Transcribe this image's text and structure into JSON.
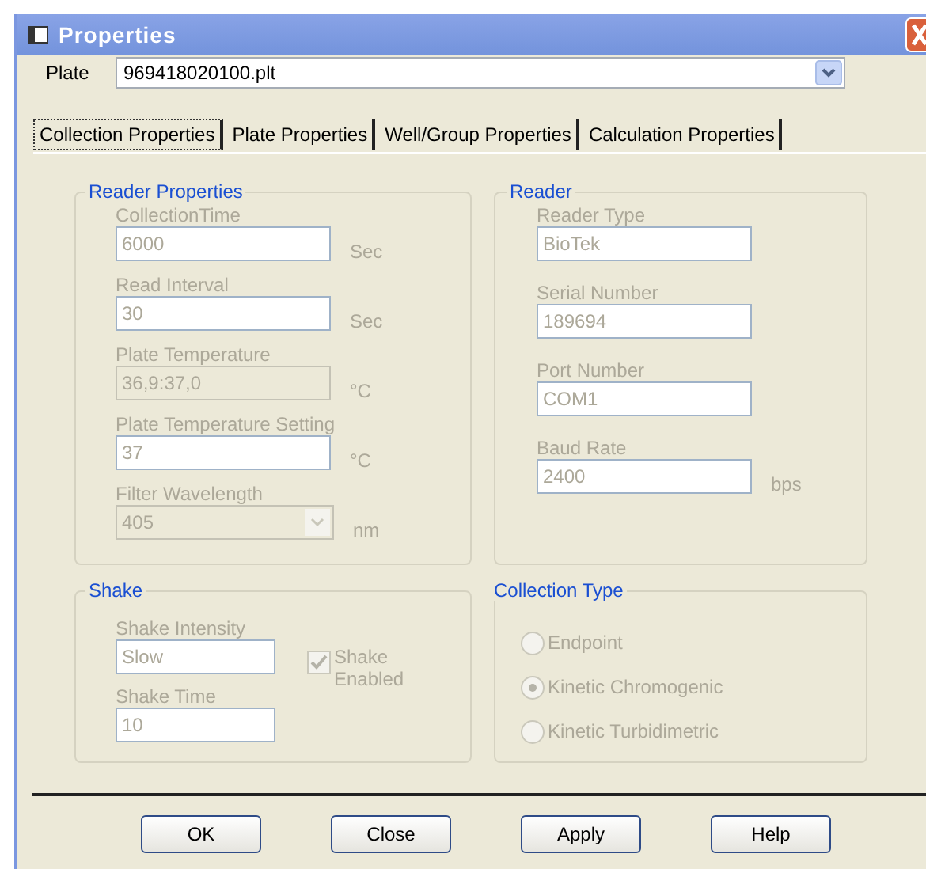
{
  "window": {
    "title": "Properties"
  },
  "plate": {
    "label": "Plate",
    "value": "969418020100.plt"
  },
  "tabs": [
    {
      "label": "Collection Properties",
      "selected": true
    },
    {
      "label": "Plate Properties",
      "selected": false
    },
    {
      "label": "Well/Group Properties",
      "selected": false
    },
    {
      "label": "Calculation Properties",
      "selected": false
    }
  ],
  "reader_properties": {
    "title": "Reader Properties",
    "fields": [
      {
        "kind": "text",
        "label": "CollectionTime",
        "value": "6000",
        "unit": "Sec",
        "disabled": false
      },
      {
        "kind": "text",
        "label": "Read Interval",
        "value": "30",
        "unit": "Sec",
        "disabled": false
      },
      {
        "kind": "text",
        "label": "Plate Temperature",
        "value": "36,9:37,0",
        "unit": "°C",
        "disabled": true
      },
      {
        "kind": "text",
        "label": "Plate Temperature Setting",
        "value": "37",
        "unit": "°C",
        "disabled": false
      },
      {
        "kind": "select",
        "label": "Filter Wavelength",
        "value": "405",
        "unit": "nm",
        "disabled": true
      }
    ]
  },
  "reader": {
    "title": "Reader",
    "fields": [
      {
        "kind": "text",
        "label": "Reader Type",
        "value": "BioTek"
      },
      {
        "kind": "text",
        "label": "Serial Number",
        "value": "189694"
      },
      {
        "kind": "text",
        "label": "Port Number",
        "value": "COM1"
      },
      {
        "kind": "text",
        "label": "Baud Rate",
        "value": "2400",
        "unit": "bps"
      }
    ]
  },
  "shake": {
    "title": "Shake",
    "intensity_label": "Shake Intensity",
    "intensity": "Slow",
    "time_label": "Shake Time",
    "time": "10",
    "enabled_label": "Shake Enabled",
    "enabled": true
  },
  "collection_type": {
    "title": "Collection Type",
    "options": [
      {
        "label": "Endpoint",
        "selected": false
      },
      {
        "label": "Kinetic Chromogenic",
        "selected": true
      },
      {
        "label": "Kinetic Turbidimetric",
        "selected": false
      }
    ]
  },
  "buttons": [
    "OK",
    "Close",
    "Apply",
    "Help"
  ]
}
